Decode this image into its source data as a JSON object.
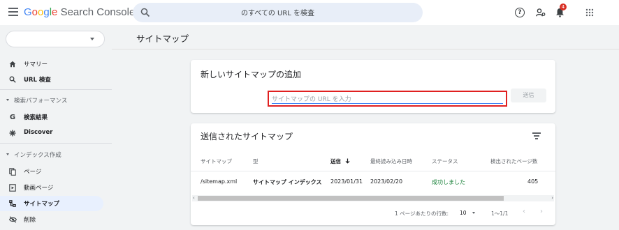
{
  "app": {
    "brand_google": "Google",
    "brand_product": "Search Console"
  },
  "search": {
    "placeholder": "のすべての URL を検査"
  },
  "header": {
    "notification_count": "4"
  },
  "sidebar": {
    "property_value": "",
    "items": [
      {
        "label": "サマリー",
        "icon": "home-icon"
      },
      {
        "label": "URL 検査",
        "icon": "search-icon"
      }
    ],
    "section_performance": {
      "label": "検索パフォーマンス",
      "items": [
        {
          "label": "検索結果",
          "icon": "google-g-icon"
        },
        {
          "label": "Discover",
          "icon": "asterisk-icon"
        }
      ]
    },
    "section_index": {
      "label": "インデックス作成",
      "items": [
        {
          "label": "ページ",
          "icon": "pages-icon"
        },
        {
          "label": "動画ページ",
          "icon": "video-page-icon"
        },
        {
          "label": "サイトマップ",
          "icon": "sitemap-icon",
          "active": true
        },
        {
          "label": "削除",
          "icon": "visibility-off-icon"
        }
      ]
    }
  },
  "page": {
    "title": "サイトマップ"
  },
  "add_card": {
    "title": "新しいサイトマップの追加",
    "input_placeholder": "サイトマップの URL を入力",
    "submit_label": "送信"
  },
  "submitted_card": {
    "title": "送信されたサイトマップ",
    "columns": [
      "サイトマップ",
      "型",
      "送信",
      "最終読み込み日時",
      "ステータス",
      "検出されたページ数"
    ],
    "rows": [
      {
        "sitemap": "/sitemap.xml",
        "type": "サイトマップ インデックス",
        "submitted": "2023/01/31",
        "last_read": "2023/02/20",
        "status": "成功しました",
        "pages": "405"
      }
    ],
    "pagination": {
      "rows_per_page_label": "1 ページあたりの行数:",
      "rows_per_page": "10",
      "range": "1～1/1"
    }
  },
  "colors": {
    "accent": "#1a73e8",
    "success": "#188038",
    "highlight_border": "#e02020",
    "active_nav_bg": "#e8f0fe"
  }
}
